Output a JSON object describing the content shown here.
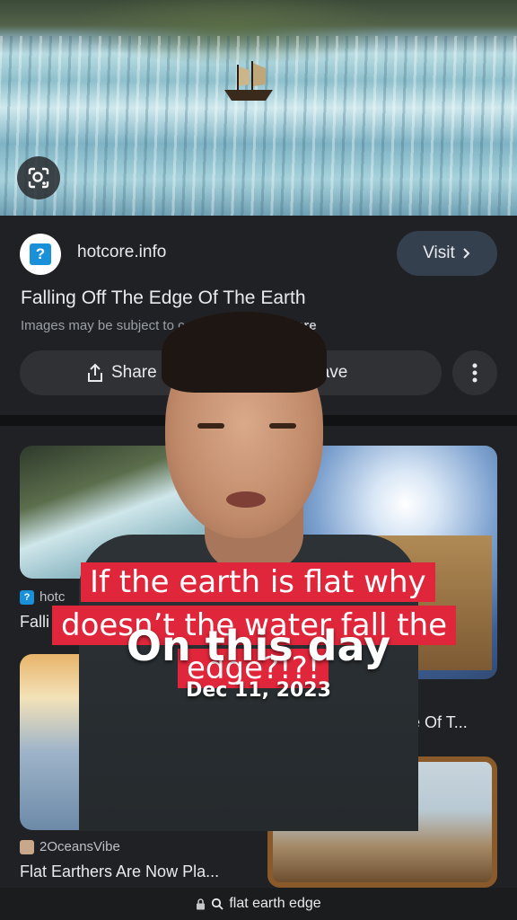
{
  "hero": {
    "lens_icon": "lens-search-icon"
  },
  "source": {
    "site_name": "hotcore.info",
    "visit_label": "Visit",
    "title": "Falling Off The Edge Of The Earth",
    "disclaimer_prefix": "Images may be subject to c",
    "disclaimer_link": "rn More",
    "share_label": "Share",
    "save_label": "Save"
  },
  "grid": {
    "item1": {
      "source": "hotc",
      "title": "Falli"
    },
    "item2": {
      "title": "e Of T..."
    },
    "item3": {
      "source": "2OceansVibe",
      "title": "Flat Earthers Are Now Pla..."
    }
  },
  "overlay": {
    "caption_line1": "If the earth is flat why",
    "caption_line2": "doesn’t the water fall the",
    "caption_line3": "edge?!?!",
    "on_this_day": "On this day",
    "date": "Dec 11, 2023"
  },
  "urlbar": {
    "text": "flat earth edge"
  },
  "colors": {
    "caption_bg": "#e0263a",
    "visit_bg": "#35404f",
    "site_icon": "#1a90d8"
  }
}
